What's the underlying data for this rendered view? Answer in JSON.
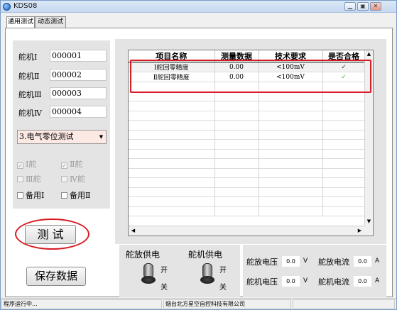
{
  "window": {
    "title": "KDS08"
  },
  "tabs": [
    {
      "label": "通用测试",
      "active": true
    },
    {
      "label": "动态测试",
      "active": false
    }
  ],
  "rudders": [
    {
      "label": "舵机Ⅰ",
      "value": "000001"
    },
    {
      "label": "舵机Ⅱ",
      "value": "000002"
    },
    {
      "label": "舵机Ⅲ",
      "value": "000003"
    },
    {
      "label": "舵机Ⅳ",
      "value": "000004"
    }
  ],
  "test_select": {
    "value": "3.电气零位测试"
  },
  "checkboxes": [
    {
      "label": "Ⅰ舵",
      "checked": true,
      "enabled": false
    },
    {
      "label": "Ⅱ舵",
      "checked": true,
      "enabled": false
    },
    {
      "label": "Ⅲ舵",
      "checked": false,
      "enabled": false
    },
    {
      "label": "Ⅳ舵",
      "checked": false,
      "enabled": false
    },
    {
      "label": "备用Ⅰ",
      "checked": false,
      "enabled": true
    },
    {
      "label": "备用Ⅱ",
      "checked": false,
      "enabled": true
    }
  ],
  "buttons": {
    "test": "测 试",
    "save": "保存数据"
  },
  "results_table": {
    "columns": [
      "项目名称",
      "测量数据",
      "技术要求",
      "是否合格"
    ],
    "rows": [
      {
        "name": "Ⅰ舵回零精度",
        "measured": "0.00",
        "requirement": "<100mV",
        "pass": "✓"
      },
      {
        "name": "Ⅱ舵回零精度",
        "measured": "0.00",
        "requirement": "<100mV",
        "pass": "✓"
      }
    ]
  },
  "power": {
    "rudder_amp_label": "舵放供电",
    "rudder_motor_label": "舵机供电",
    "on_label": "开",
    "off_label": "关"
  },
  "measurements": [
    {
      "label": "舵放电压",
      "value": "0.0",
      "unit": "V"
    },
    {
      "label": "舵放电流",
      "value": "0.0",
      "unit": "A"
    },
    {
      "label": "舵机电压",
      "value": "0.0",
      "unit": "V"
    },
    {
      "label": "舵机电流",
      "value": "0.0",
      "unit": "A"
    }
  ],
  "status": {
    "message": "程序运行中...",
    "company": "烟台北方星空自控科技有限公司"
  },
  "colors": {
    "highlight": "#d81b24",
    "check_ok": "#2fb52f",
    "combo_bg": "#fde9e4"
  }
}
